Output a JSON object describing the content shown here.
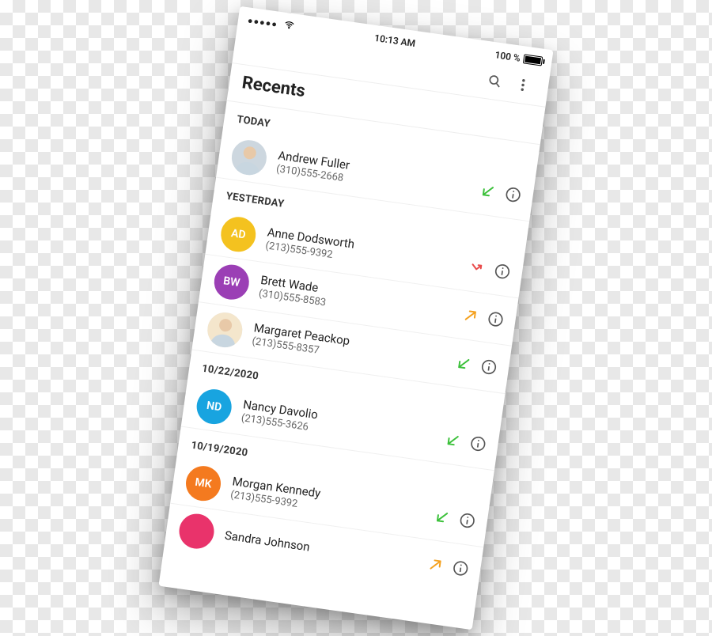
{
  "status": {
    "signal_dots": "●●●●●",
    "time": "10:13 AM",
    "battery_text": "100 %"
  },
  "toolbar": {
    "search_icon": "search-icon",
    "more_icon": "more-vert-icon"
  },
  "page": {
    "title": "Recents"
  },
  "sections": [
    {
      "header": "TODAY",
      "rows": [
        {
          "name": "Andrew Fuller",
          "phone": "(310)555-2668",
          "avatar": {
            "type": "photo",
            "color": "#cdd7df"
          },
          "direction": {
            "type": "incoming",
            "color": "#3cc13b"
          }
        }
      ]
    },
    {
      "header": "YESTERDAY",
      "rows": [
        {
          "name": "Anne Dodsworth",
          "phone": "(213)555-9392",
          "avatar": {
            "type": "initials",
            "text": "AD",
            "color": "#f4c21f"
          },
          "direction": {
            "type": "missed",
            "color": "#e94b4b"
          }
        },
        {
          "name": "Brett Wade",
          "phone": "(310)555-8583",
          "avatar": {
            "type": "initials",
            "text": "BW",
            "color": "#9b3fb5"
          },
          "direction": {
            "type": "outgoing",
            "color": "#f4a11f"
          }
        },
        {
          "name": "Margaret Peackop",
          "phone": "(213)555-8357",
          "avatar": {
            "type": "photo",
            "color": "#f4e6cc"
          },
          "direction": {
            "type": "incoming",
            "color": "#3cc13b"
          }
        }
      ]
    },
    {
      "header": "10/22/2020",
      "rows": [
        {
          "name": "Nancy Davolio",
          "phone": "(213)555-3626",
          "avatar": {
            "type": "initials",
            "text": "ND",
            "color": "#18a4e0"
          },
          "direction": {
            "type": "incoming",
            "color": "#3cc13b"
          }
        }
      ]
    },
    {
      "header": "10/19/2020",
      "rows": [
        {
          "name": "Morgan Kennedy",
          "phone": "(213)555-9392",
          "avatar": {
            "type": "initials",
            "text": "MK",
            "color": "#f47a1f"
          },
          "direction": {
            "type": "incoming",
            "color": "#3cc13b"
          }
        },
        {
          "name": "Sandra Johnson",
          "phone": "",
          "avatar": {
            "type": "initials",
            "text": "",
            "color": "#e9336b"
          },
          "direction": {
            "type": "outgoing",
            "color": "#f4a11f"
          }
        }
      ]
    }
  ]
}
